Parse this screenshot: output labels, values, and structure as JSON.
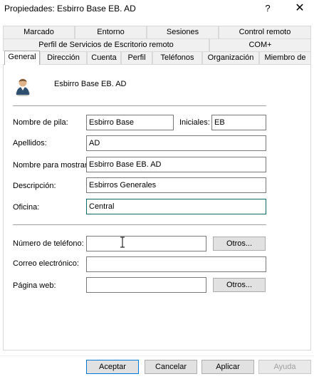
{
  "window": {
    "title": "Propiedades: Esbirro Base EB. AD",
    "help": "?",
    "close": "✕"
  },
  "tabs_row1": [
    "Marcado",
    "Entorno",
    "Sesiones",
    "Control remoto"
  ],
  "tabs_row2": [
    "Perfil de Servicios de Escritorio remoto",
    "COM+"
  ],
  "tabs_row3": [
    "General",
    "Dirección",
    "Cuenta",
    "Perfil",
    "Teléfonos",
    "Organización",
    "Miembro de"
  ],
  "active_tab": "General",
  "header": {
    "display_name": "Esbirro Base EB. AD",
    "icon": "user-icon"
  },
  "form": {
    "first_name_label": "Nombre de pila:",
    "first_name": "Esbirro Base",
    "initials_label": "Iniciales:",
    "initials": "EB",
    "last_name_label": "Apellidos:",
    "last_name": "AD",
    "display_label": "Nombre para mostrar:",
    "display_value": "Esbirro Base EB. AD",
    "description_label": "Descripción:",
    "description": "Esbirros Generales",
    "office_label": "Oficina:",
    "office": "Central",
    "phone_label": "Número de teléfono:",
    "phone": "",
    "email_label": "Correo electrónico:",
    "email": "",
    "web_label": "Página web:",
    "web": "",
    "others_label": "Otros..."
  },
  "footer": {
    "ok": "Aceptar",
    "cancel": "Cancelar",
    "apply": "Aplicar",
    "help": "Ayuda"
  },
  "colors": {
    "primary_border": "#0078d7",
    "focus_border": "#0d6b6b",
    "button_bg": "#e1e1e1"
  }
}
